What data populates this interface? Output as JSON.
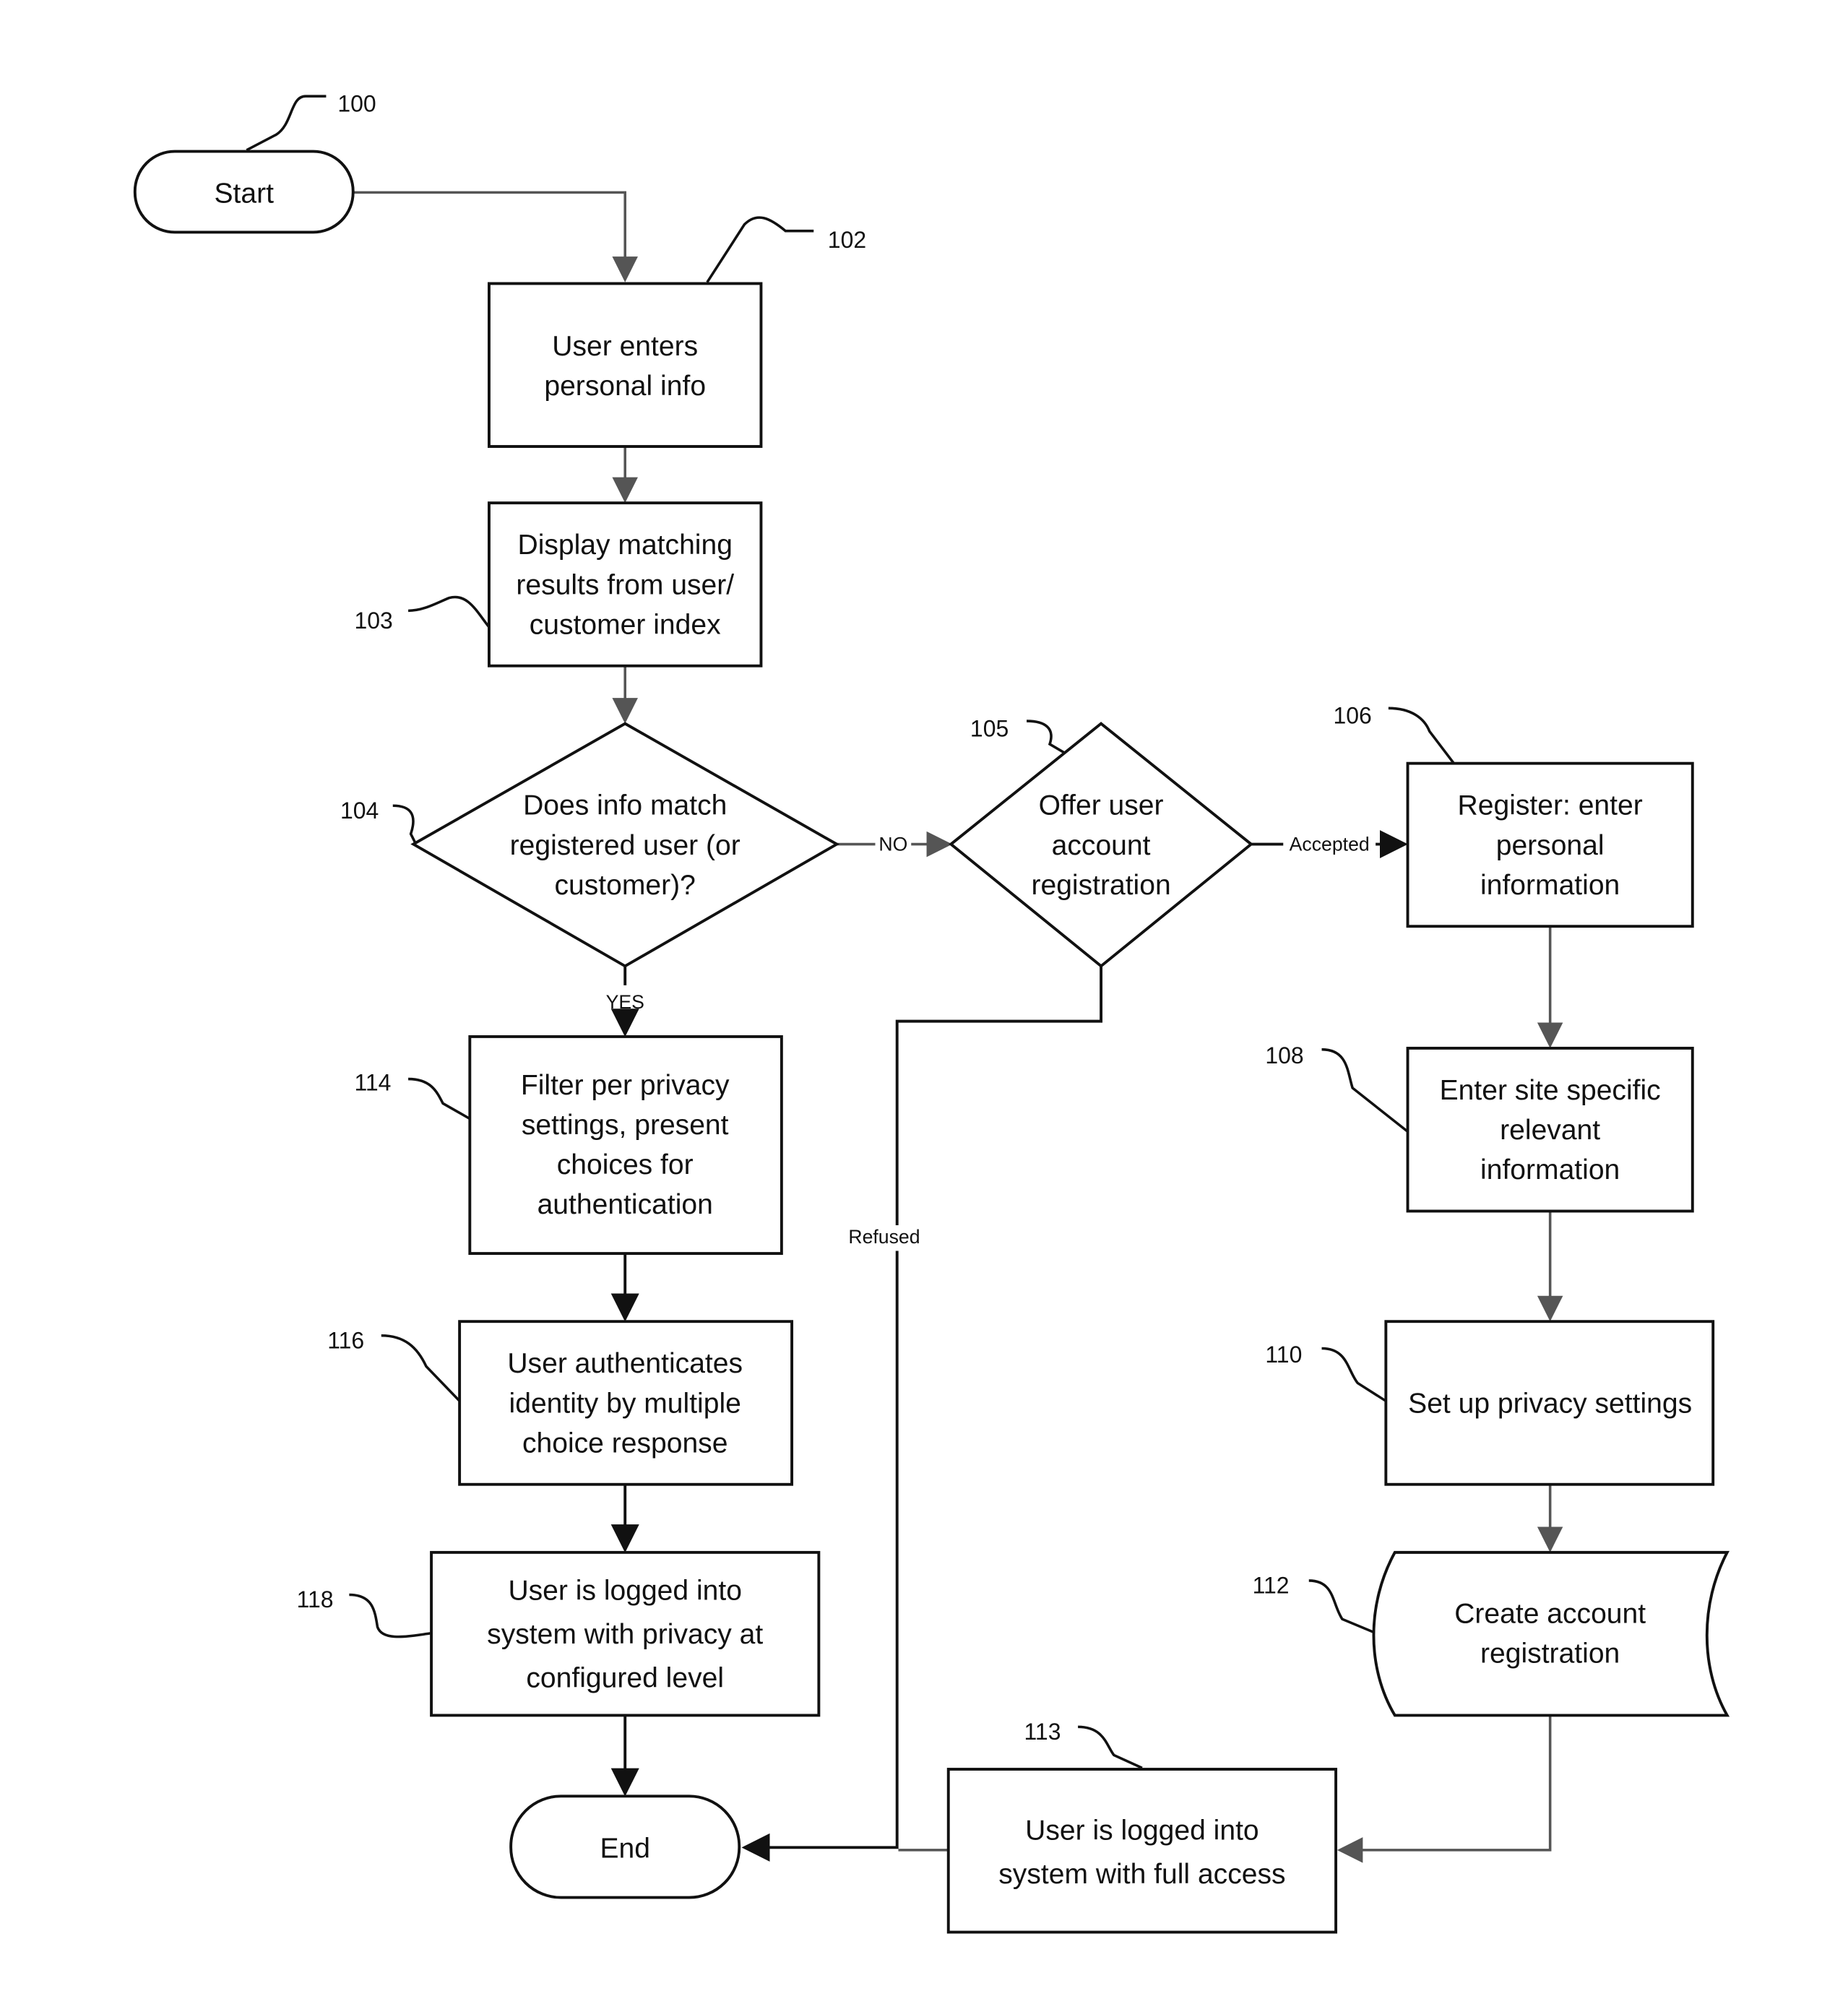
{
  "nodes": {
    "start": {
      "ref": "100",
      "lines": [
        "Start"
      ]
    },
    "n102": {
      "ref": "102",
      "lines": [
        "User enters",
        "personal info"
      ]
    },
    "n103": {
      "ref": "103",
      "lines": [
        "Display matching",
        "results from user/",
        "customer index"
      ]
    },
    "n104": {
      "ref": "104",
      "lines": [
        "Does info match",
        "registered user (or",
        "customer)?"
      ]
    },
    "n105": {
      "ref": "105",
      "lines": [
        "Offer user",
        "account",
        "registration"
      ]
    },
    "n106": {
      "ref": "106",
      "lines": [
        "Register: enter",
        "personal",
        "information"
      ]
    },
    "n108": {
      "ref": "108",
      "lines": [
        "Enter site specific",
        "relevant",
        "information"
      ]
    },
    "n110": {
      "ref": "110",
      "lines": [
        "Set up privacy settings"
      ]
    },
    "n112": {
      "ref": "112",
      "lines": [
        "Create account",
        "registration"
      ]
    },
    "n113": {
      "ref": "113",
      "lines": [
        "User is logged into",
        "system with full access"
      ]
    },
    "n114": {
      "ref": "114",
      "lines": [
        "Filter per privacy",
        "settings, present",
        "choices for",
        "authentication"
      ]
    },
    "n116": {
      "ref": "116",
      "lines": [
        "User authenticates",
        "identity by multiple",
        "choice response"
      ]
    },
    "n118": {
      "ref": "118",
      "lines": [
        "User is logged into",
        "system with privacy at",
        "configured level"
      ]
    },
    "end": {
      "lines": [
        "End"
      ]
    }
  },
  "edges": {
    "no": "NO",
    "yes": "YES",
    "accepted": "Accepted",
    "refused": "Refused"
  }
}
